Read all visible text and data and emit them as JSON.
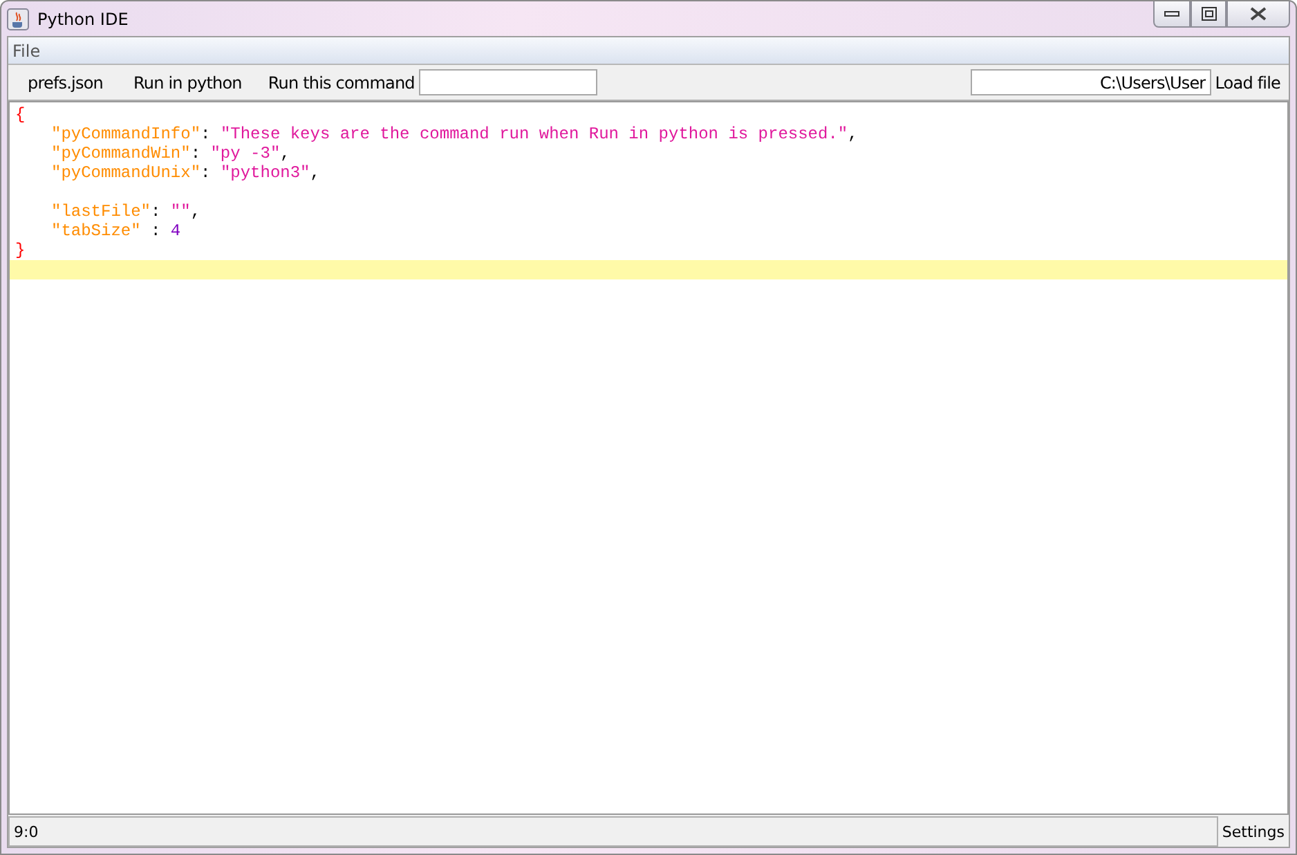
{
  "window": {
    "title": "Python IDE"
  },
  "menu": [
    {
      "label": "File"
    }
  ],
  "toolbar": {
    "tabs": [
      {
        "label": "prefs.json"
      },
      {
        "label": "Run in python"
      }
    ],
    "command_label": "Run this command",
    "path_field": {
      "value": "C:\\Users\\User"
    },
    "load_button": "Load file"
  },
  "editor": {
    "lines": [
      {
        "kind": "code",
        "indented": false,
        "current": false,
        "tokens": [
          {
            "kind": "brace",
            "text": "{"
          }
        ]
      },
      {
        "kind": "code",
        "indented": true,
        "current": false,
        "tokens": [
          {
            "kind": "key",
            "text": "\"pyCommandInfo\""
          },
          {
            "kind": "punct",
            "text": ": "
          },
          {
            "kind": "string",
            "text": "\"These keys are the command run when Run in python is pressed.\""
          },
          {
            "kind": "punct",
            "text": ","
          }
        ]
      },
      {
        "kind": "code",
        "indented": true,
        "current": false,
        "tokens": [
          {
            "kind": "key",
            "text": "\"pyCommandWin\""
          },
          {
            "kind": "punct",
            "text": ": "
          },
          {
            "kind": "string",
            "text": "\"py -3\""
          },
          {
            "kind": "punct",
            "text": ","
          }
        ]
      },
      {
        "kind": "code",
        "indented": true,
        "current": false,
        "tokens": [
          {
            "kind": "key",
            "text": "\"pyCommandUnix\""
          },
          {
            "kind": "punct",
            "text": ": "
          },
          {
            "kind": "string",
            "text": "\"python3\""
          },
          {
            "kind": "punct",
            "text": ","
          }
        ]
      },
      {
        "kind": "blank",
        "current": false
      },
      {
        "kind": "code",
        "indented": true,
        "current": false,
        "tokens": [
          {
            "kind": "key",
            "text": "\"lastFile\""
          },
          {
            "kind": "punct",
            "text": ": "
          },
          {
            "kind": "string",
            "text": "\"\""
          },
          {
            "kind": "punct",
            "text": ","
          }
        ]
      },
      {
        "kind": "code",
        "indented": true,
        "current": false,
        "tokens": [
          {
            "kind": "key",
            "text": "\"tabSize\""
          },
          {
            "kind": "punct",
            "text": " : "
          },
          {
            "kind": "number",
            "text": "4"
          }
        ]
      },
      {
        "kind": "code",
        "indented": false,
        "current": false,
        "tokens": [
          {
            "kind": "brace",
            "text": "}"
          }
        ]
      },
      {
        "kind": "blank",
        "current": true
      }
    ]
  },
  "status_bar": {
    "position": "9:0",
    "settings_button": "Settings"
  }
}
